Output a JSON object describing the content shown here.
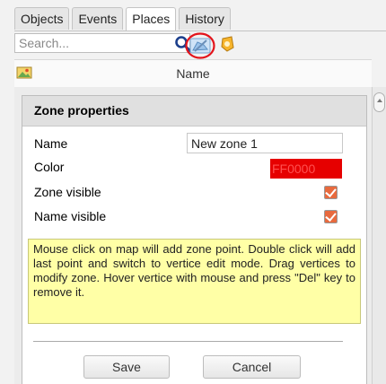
{
  "tabs": [
    {
      "label": "Objects",
      "active": false
    },
    {
      "label": "Events",
      "active": false
    },
    {
      "label": "Places",
      "active": true
    },
    {
      "label": "History",
      "active": false
    }
  ],
  "search": {
    "placeholder": "Search...",
    "value": ""
  },
  "toolbar": {
    "search_icon": "search-icon",
    "zone_tool_icon": "zone-edit-icon",
    "place_tool_icon": "place-marker-icon",
    "highlight_color": "#e3141b"
  },
  "list_header": {
    "label": "Name",
    "icon": "image-icon"
  },
  "zone_properties": {
    "title": "Zone properties",
    "name_label": "Name",
    "name_value": "New zone 1",
    "color_label": "Color",
    "color_value": "FF0000",
    "zone_visible_label": "Zone visible",
    "zone_visible": true,
    "name_visible_label": "Name visible",
    "name_visible": true,
    "hint": "Mouse click on map will add zone point. Double click will add last point and switch to vertice edit mode. Drag vertices to modify zone. Hover vertice with mouse and press \"Del\" key to remove it.",
    "save_label": "Save",
    "cancel_label": "Cancel"
  },
  "colors": {
    "swatch": "#e60000",
    "checkbox": "#e86a3e",
    "hint_bg": "#ffffa6"
  }
}
